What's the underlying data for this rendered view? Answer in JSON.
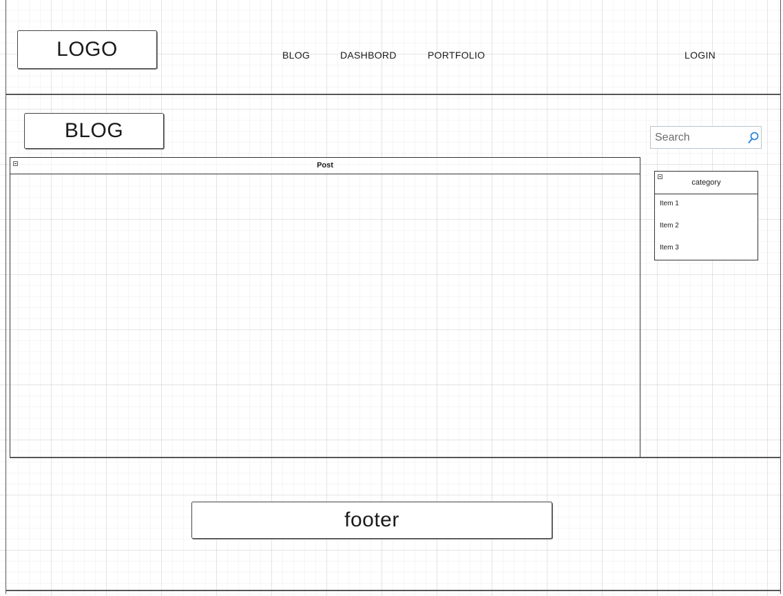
{
  "header": {
    "logo_text": "LOGO",
    "nav": [
      {
        "label": "BLOG"
      },
      {
        "label": "DASHBORD"
      },
      {
        "label": "PORTFOLIO"
      }
    ],
    "login_label": "LOGIN"
  },
  "main": {
    "page_title": "BLOG",
    "search": {
      "placeholder": "Search",
      "icon": "search-icon"
    },
    "post_panel": {
      "title": "Post",
      "icon": "minimize-icon"
    },
    "category_panel": {
      "title": "category",
      "icon": "minimize-icon",
      "items": [
        {
          "label": "Item 1"
        },
        {
          "label": "Item 2"
        },
        {
          "label": "Item 3"
        }
      ]
    }
  },
  "footer": {
    "label": "footer"
  },
  "colors": {
    "search_icon": "#2e86de",
    "line": "#555555"
  }
}
